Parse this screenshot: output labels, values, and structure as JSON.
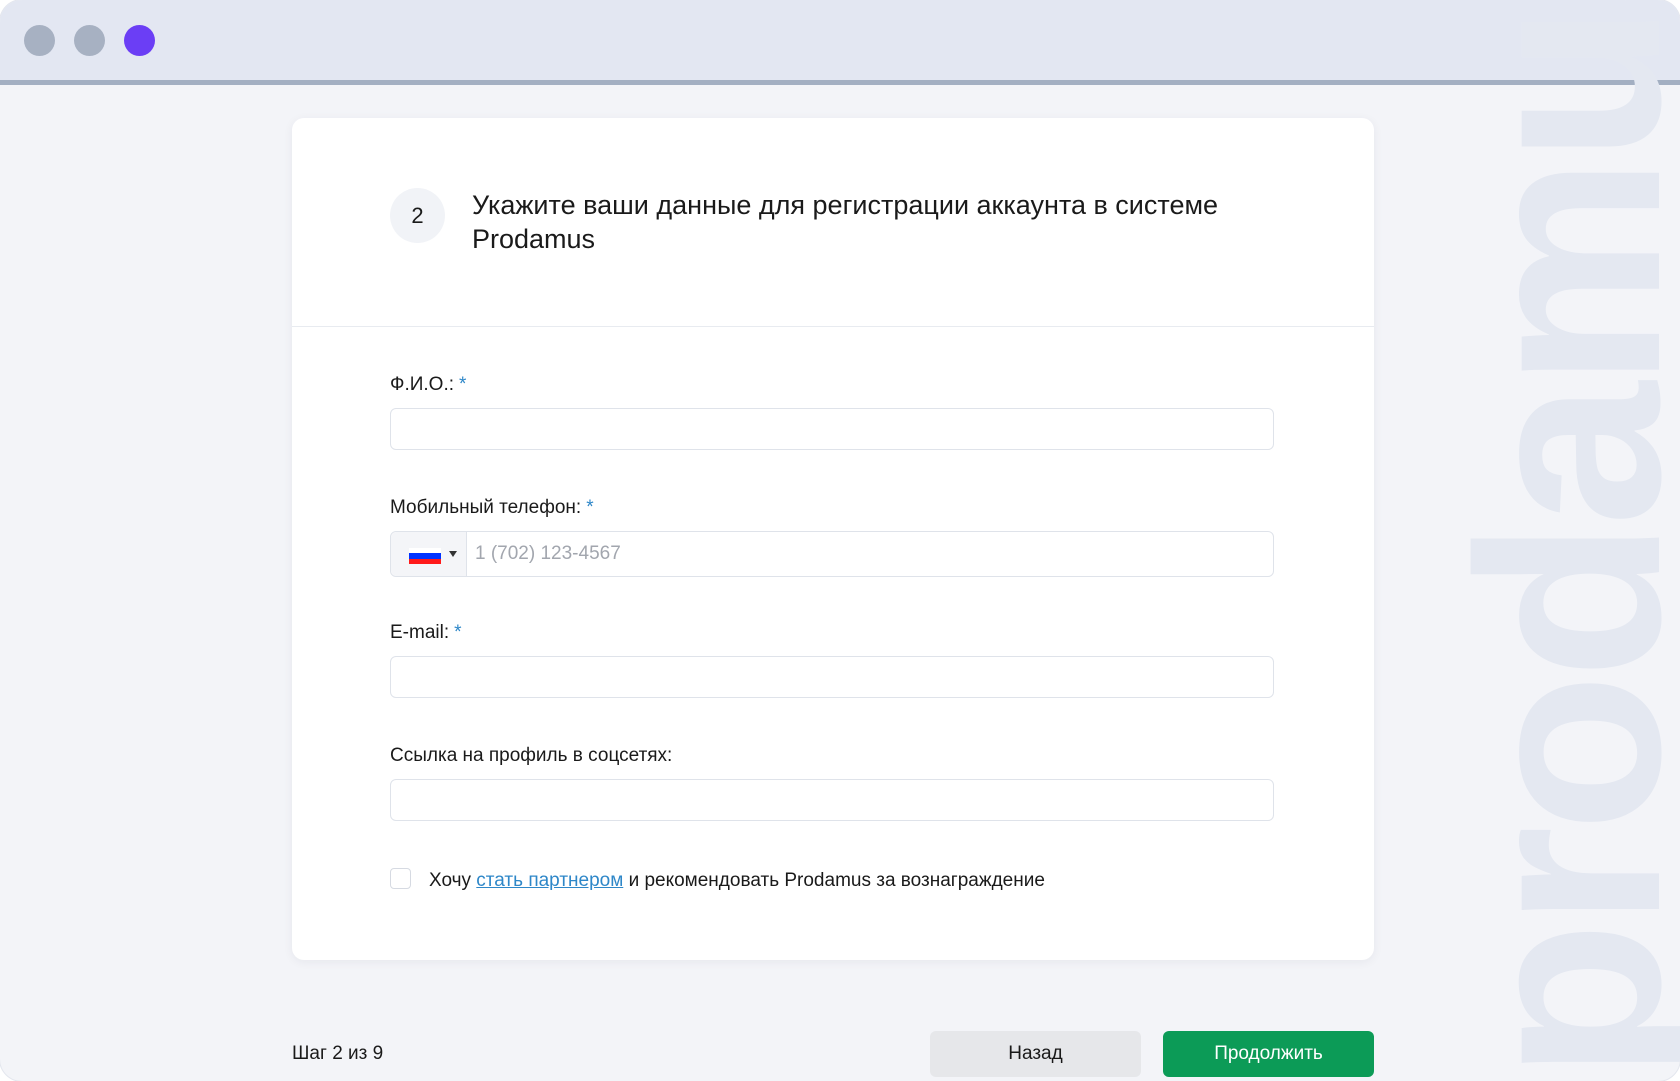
{
  "window": {
    "controls": [
      "close",
      "minimize",
      "maximize"
    ],
    "accent_color": "#6b3ef5"
  },
  "watermark": {
    "text": "prodamus"
  },
  "card": {
    "step_number": "2",
    "title": "Укажите ваши данные для регистрации аккаунта в системе Prodamus"
  },
  "form": {
    "fullname": {
      "label": "Ф.И.О.:",
      "required_mark": "*",
      "value": ""
    },
    "phone": {
      "label": "Мобильный телефон:",
      "required_mark": "*",
      "country": "RU",
      "flag_colors": [
        "#ffffff",
        "#0033ff",
        "#ff1a1a"
      ],
      "placeholder": "1 (702) 123-4567",
      "value": ""
    },
    "email": {
      "label": "E-mail:",
      "required_mark": "*",
      "value": ""
    },
    "social": {
      "label": "Ссылка на профиль в соцсетях:",
      "value": ""
    },
    "partner": {
      "checked": false,
      "text_before": "Хочу",
      "link_text": "стать партнером",
      "text_after": "и рекомендовать Prodamus за вознаграждение"
    }
  },
  "footer": {
    "step_counter": "Шаг 2 из 9",
    "back_label": "Назад",
    "continue_label": "Продолжить",
    "continue_color": "#0c9b57"
  }
}
